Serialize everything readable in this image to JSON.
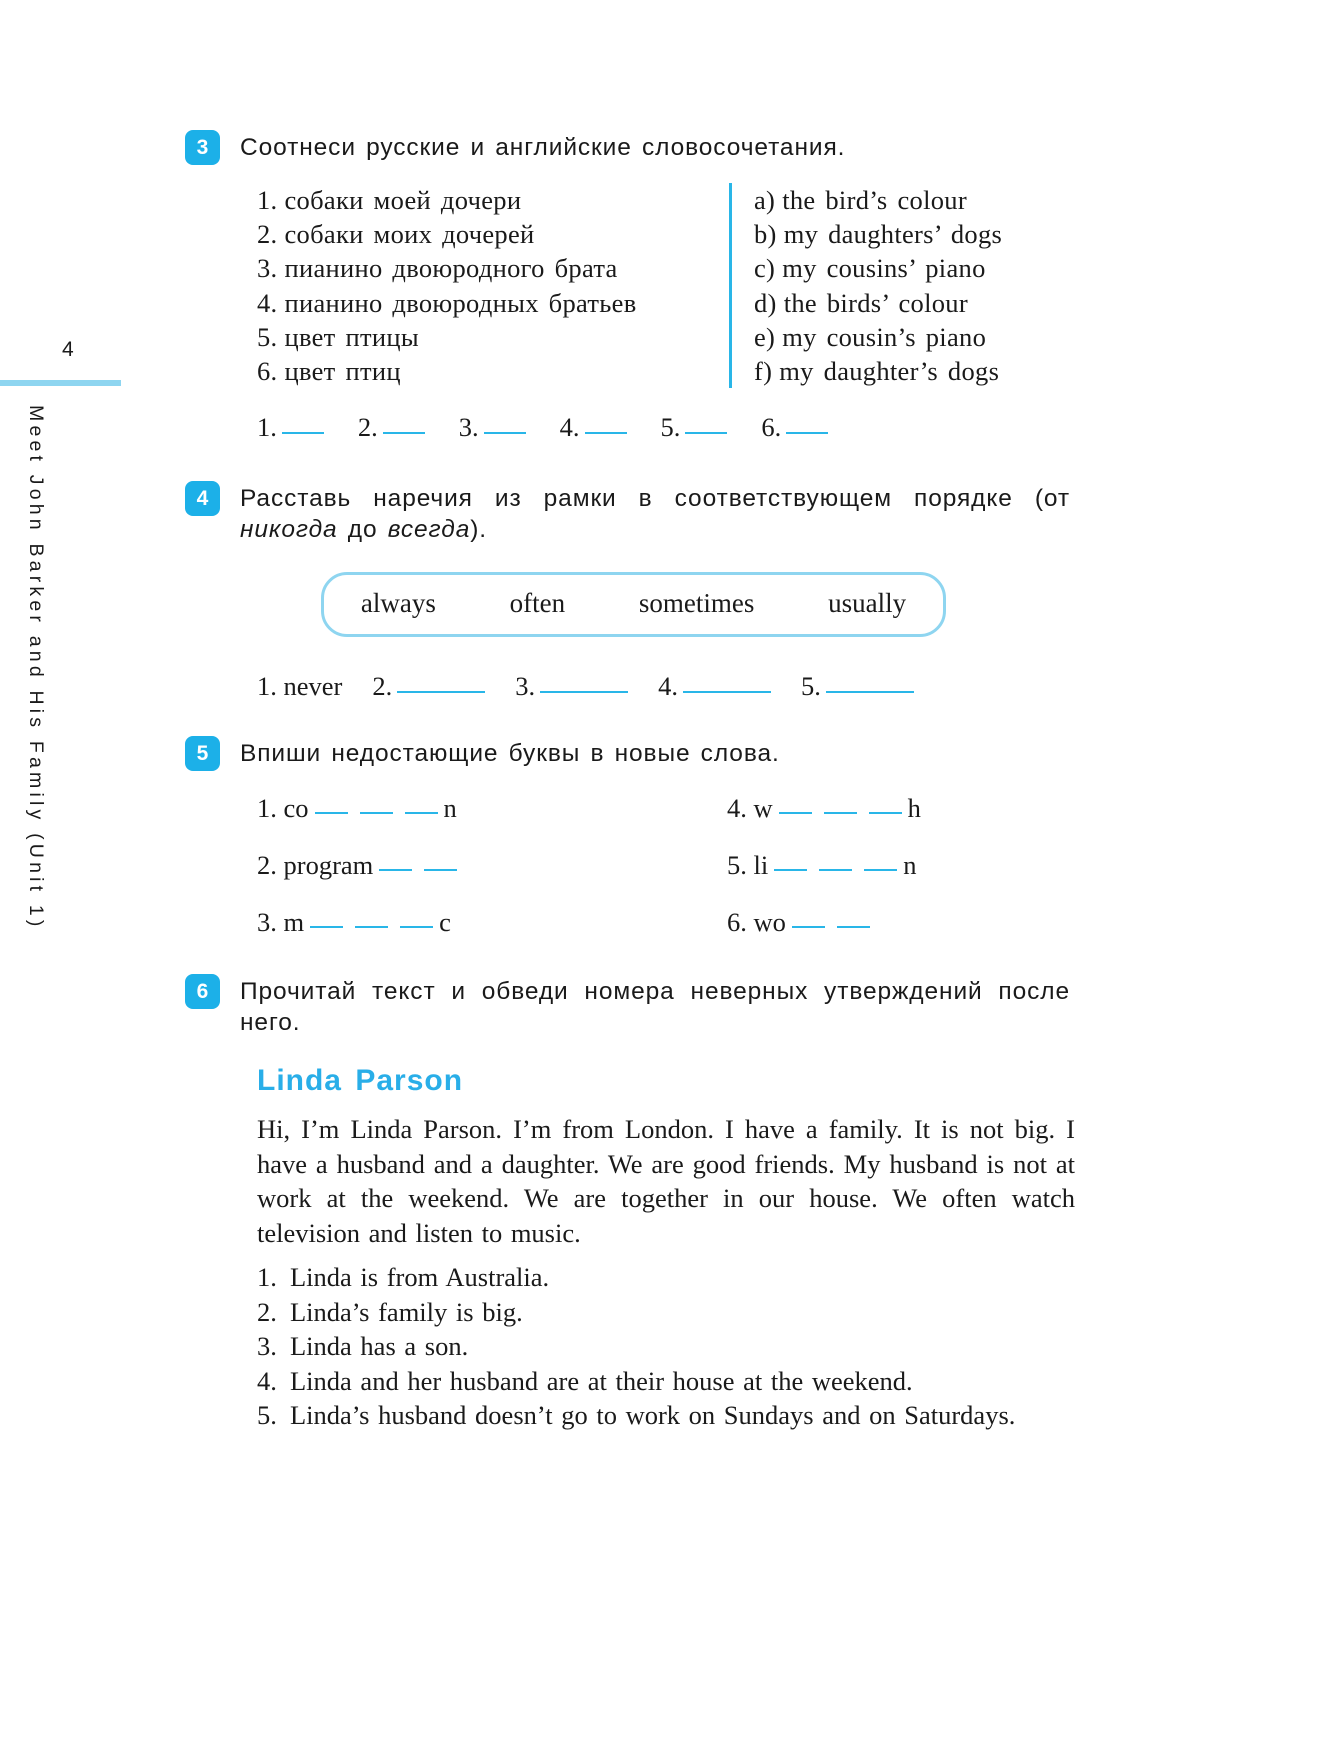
{
  "sidebar": {
    "page_number": "4",
    "running_title": "Meet John Barker and His Family (Unit 1)"
  },
  "exercises": [
    {
      "number": "3",
      "prompt": "Соотнеси русские и английские словосочетания.",
      "left_items": [
        {
          "label": "1.",
          "text": "собаки моей дочери"
        },
        {
          "label": "2.",
          "text": "собаки моих дочерей"
        },
        {
          "label": "3.",
          "text": "пианино двоюродного брата"
        },
        {
          "label": "4.",
          "text": "пианино двоюродных братьев"
        },
        {
          "label": "5.",
          "text": "цвет птицы"
        },
        {
          "label": "6.",
          "text": "цвет птиц"
        }
      ],
      "right_items": [
        {
          "label": "a)",
          "text": "the bird’s colour"
        },
        {
          "label": "b)",
          "text": "my daughters’ dogs"
        },
        {
          "label": "c)",
          "text": "my cousins’ piano"
        },
        {
          "label": "d)",
          "text": "the birds’ colour"
        },
        {
          "label": "e)",
          "text": "my cousin’s piano"
        },
        {
          "label": "f)",
          "text": "my daughter’s dogs"
        }
      ],
      "answer_slots": [
        "1.",
        "2.",
        "3.",
        "4.",
        "5.",
        "6."
      ]
    },
    {
      "number": "4",
      "prompt_part1": "Расставь наречия из рамки в соответствующем порядке (от ",
      "prompt_italic1": "никогда",
      "prompt_part2": " до ",
      "prompt_italic2": "всегда",
      "prompt_part3": ").",
      "word_box": [
        "always",
        "often",
        "sometimes",
        "usually"
      ],
      "answer_line": {
        "item1_label": "1.",
        "item1_value": "never",
        "item2_label": "2.",
        "item3_label": "3.",
        "item4_label": "4.",
        "item5_label": "5."
      }
    },
    {
      "number": "5",
      "prompt": "Впиши недостающие буквы в новые слова.",
      "items": [
        {
          "label": "1.",
          "prefix": "co",
          "gaps": 3,
          "suffix": "n"
        },
        {
          "label": "4.",
          "prefix": "w",
          "gaps": 3,
          "suffix": "h"
        },
        {
          "label": "2.",
          "prefix": "program",
          "gaps": 2,
          "suffix": ""
        },
        {
          "label": "5.",
          "prefix": "li",
          "gaps": 3,
          "suffix": "n"
        },
        {
          "label": "3.",
          "prefix": "m",
          "gaps": 3,
          "suffix": "c"
        },
        {
          "label": "6.",
          "prefix": "wo",
          "gaps": 2,
          "suffix": ""
        }
      ]
    },
    {
      "number": "6",
      "prompt": "Прочитай текст и обведи номера неверных утверждений после него.",
      "story_title": "Linda Parson",
      "story_text": "Hi, I’m Linda Parson. I’m from London. I have a family. It is not big. I have a husband and a daughter. We are good friends. My husband is not at work at the weekend. We are together in our house. We often watch television and listen to music.",
      "statements": [
        {
          "number": "1.",
          "text": "Linda is from Australia."
        },
        {
          "number": "2.",
          "text": "Linda’s family is big."
        },
        {
          "number": "3.",
          "text": "Linda has a son."
        },
        {
          "number": "4.",
          "text": "Linda and her husband are at their house at the weekend."
        },
        {
          "number": "5.",
          "text": "Linda’s husband doesn’t go to work on Sundays and on Saturdays."
        }
      ]
    }
  ],
  "colors": {
    "accent": "#1cb0e8",
    "rule": "#8ed5f0",
    "blank": "#29b6e8",
    "title": "#29aee8"
  }
}
